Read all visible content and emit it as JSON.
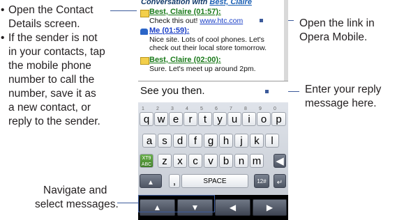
{
  "left_callouts": {
    "bullet_1": [
      "Open the Contact",
      "Details screen."
    ],
    "bullet_2": [
      "If the sender is not",
      "in your contacts, tap",
      "the mobile phone",
      "number to call the",
      "number, save it as",
      "a new contact, or",
      "reply to the sender."
    ],
    "bullet_symbol": "•",
    "navigate": [
      "Navigate and",
      "select messages."
    ]
  },
  "right_callouts": {
    "open_link": [
      "Open the link in",
      "Opera Mobile."
    ],
    "enter_reply": [
      "Enter your reply",
      "message here."
    ]
  },
  "phone": {
    "conversation_title_prefix": "Conversation with ",
    "conversation_title_contact": "Best, Claire",
    "messages": [
      {
        "sender": "Best, Claire (01:57):",
        "lines": [
          "Check this out! "
        ],
        "url": "www.htc.com",
        "icon": "envelope-icon"
      },
      {
        "sender": "Me (01:59):",
        "lines": [
          "Nice site. Lots of cool phones. Let's",
          "check out their local store tomorrow."
        ],
        "icon": "person-icon"
      },
      {
        "sender": "Best, Claire (02:00):",
        "lines": [
          "Sure. Let's meet up around 2pm."
        ],
        "icon": "envelope-icon"
      }
    ],
    "reply_value": "See you then.",
    "keyboard": {
      "row1": [
        "q",
        "w",
        "e",
        "r",
        "t",
        "y",
        "u",
        "i",
        "o",
        "p"
      ],
      "row1_sub": [
        "1",
        "2",
        "3",
        "4",
        "5",
        "6",
        "7",
        "8",
        "9",
        "0"
      ],
      "row2": [
        "a",
        "s",
        "d",
        "f",
        "g",
        "h",
        "j",
        "k",
        "l"
      ],
      "row3": [
        "z",
        "x",
        "c",
        "v",
        "b",
        "n",
        "m"
      ],
      "xt9_label": "XT9",
      "abc_label": "ABC",
      "space_label": "SPACE",
      "symbols_label": "12#",
      "comma_label": ","
    }
  },
  "colors": {
    "callout_line": "#3c5a9a",
    "sender_green": "#1a7a1a",
    "sender_me_blue": "#1a3fc7"
  }
}
